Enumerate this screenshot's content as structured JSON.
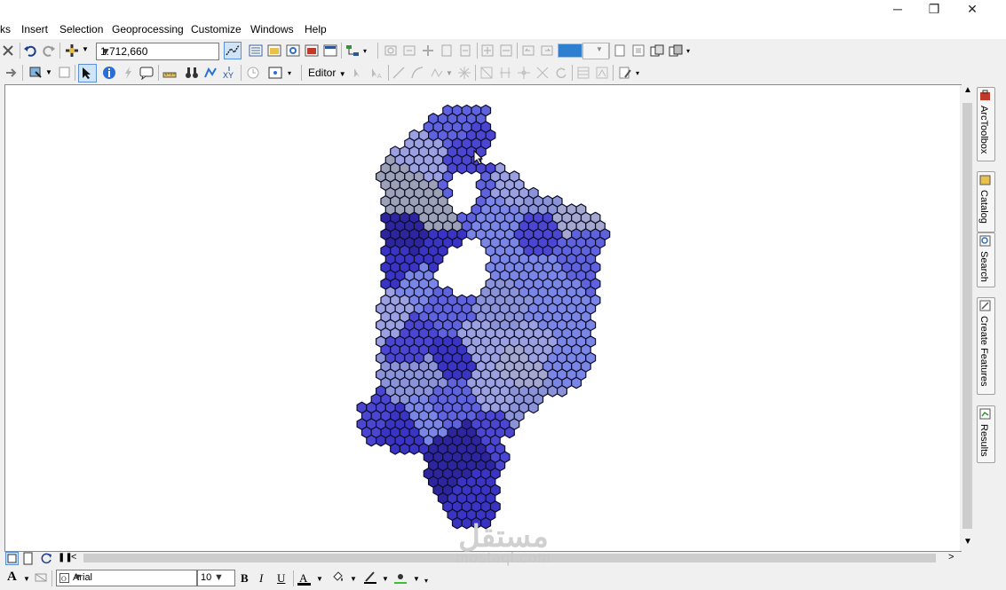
{
  "window": {
    "minimize": "─",
    "restore": "❐",
    "close": "✕"
  },
  "menu": [
    "ks",
    "Insert",
    "Selection",
    "Geoprocessing",
    "Customize",
    "Windows",
    "Help"
  ],
  "toolbar": {
    "scale": "1:712,660",
    "editor_label": "Editor"
  },
  "dock": {
    "arctoolbox": "ArcToolbox",
    "catalog": "Catalog",
    "search": "Search",
    "create_features": "Create Features",
    "results": "Results"
  },
  "drawing": {
    "font": "Arial",
    "size": "10",
    "bold": "B",
    "italic": "I",
    "underline": "U",
    "text_a": "A"
  },
  "watermark": {
    "arabic": "مستقل",
    "latin": "mostaql.com"
  },
  "colors": {
    "palette": [
      "#2c259e",
      "#3a34c4",
      "#4a46d2",
      "#5e63dd",
      "#7a86e6",
      "#8b93d8",
      "#9aa0e0",
      "#a4a8cf",
      "#9da1b5"
    ]
  }
}
